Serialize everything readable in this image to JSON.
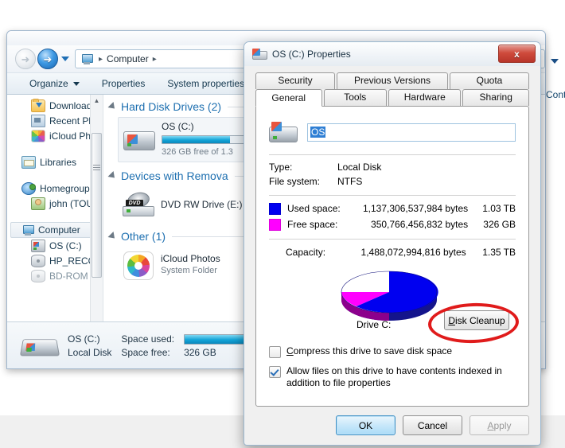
{
  "explorer": {
    "address": {
      "crumb_root": "Computer",
      "separator": "▸"
    },
    "nav": {
      "back_label": "back-arrow",
      "forward_label": "forward-arrow"
    },
    "toolbar": {
      "organize": "Organize",
      "properties": "Properties",
      "system_properties": "System properties",
      "control_panel_partial": "Contr"
    },
    "navpane": [
      {
        "label": "Downloads",
        "icon": "downloads-folder-icon",
        "indent": 2
      },
      {
        "label": "Recent Plac",
        "icon": "recent-places-icon",
        "indent": 2
      },
      {
        "label": "iCloud Pho",
        "icon": "icloud-photos-icon",
        "indent": 2
      },
      {
        "label": "Libraries",
        "icon": "libraries-icon",
        "indent": 1
      },
      {
        "label": "Homegroup",
        "icon": "homegroup-icon",
        "indent": 1
      },
      {
        "label": "john (TOUC",
        "icon": "user-icon",
        "indent": 2
      },
      {
        "label": "Computer",
        "icon": "computer-icon",
        "indent": 1,
        "selected": true
      },
      {
        "label": "OS (C:)",
        "icon": "hard-drive-windows-icon",
        "indent": 2
      },
      {
        "label": "HP_RECOV",
        "icon": "hard-drive-icon",
        "indent": 2
      },
      {
        "label": "BD-ROM D",
        "icon": "optical-drive-icon",
        "indent": 2
      }
    ],
    "groups": [
      {
        "title": "Hard Disk Drives (2)",
        "items": [
          {
            "name": "OS (C:)",
            "sub": "326 GB free of 1.3",
            "bar_percent": 76,
            "icon": "hard-drive-windows-icon",
            "selected": true
          }
        ]
      },
      {
        "title": "Devices with Remova",
        "items": [
          {
            "name": "DVD RW Drive (E:)",
            "sub": "",
            "icon": "dvd-drive-icon"
          }
        ]
      },
      {
        "title": "Other (1)",
        "items": [
          {
            "name": "iCloud Photos",
            "sub": "System Folder",
            "icon": "icloud-photos-icon"
          }
        ]
      }
    ],
    "statusbar": {
      "name": "OS (C:)",
      "type": "Local Disk",
      "space_used_label": "Space used:",
      "space_free_label": "Space free:",
      "space_free_value": "326 GB",
      "used_percent": 76
    }
  },
  "dialog": {
    "title": "OS (C:) Properties",
    "close_label": "x",
    "tabs_top": [
      {
        "label": "Security",
        "active": false
      },
      {
        "label": "Previous Versions",
        "active": false
      },
      {
        "label": "Quota",
        "active": false
      }
    ],
    "tabs_bottom": [
      {
        "label": "General",
        "active": true
      },
      {
        "label": "Tools",
        "active": false
      },
      {
        "label": "Hardware",
        "active": false
      },
      {
        "label": "Sharing",
        "active": false
      }
    ],
    "volume_name": "OS",
    "info": [
      {
        "key": "Type:",
        "value": "Local Disk"
      },
      {
        "key": "File system:",
        "value": "NTFS"
      }
    ],
    "usage": {
      "used": {
        "label": "Used space:",
        "bytes": "1,137,306,537,984 bytes",
        "human": "1.03 TB",
        "color": "#0000f0"
      },
      "free": {
        "label": "Free space:",
        "bytes": "350,766,456,832 bytes",
        "human": "326 GB",
        "color": "#ff00ff"
      },
      "capacity": {
        "label": "Capacity:",
        "bytes": "1,488,072,994,816 bytes",
        "human": "1.35 TB"
      }
    },
    "drive_label": "Drive C:",
    "disk_cleanup_button": "Disk Cleanup",
    "disk_cleanup_accel": "D",
    "annotation": {
      "shape": "red-ellipse",
      "color": "#e01b1b",
      "target": "Disk Cleanup"
    },
    "checkboxes": [
      {
        "label_accel": "C",
        "label": "ompress this drive to save disk space",
        "checked": false
      },
      {
        "label_accel": "",
        "label": "Allow files on this drive to have contents indexed in addition to file properties",
        "checked": true
      }
    ],
    "buttons": [
      {
        "label": "OK",
        "state": "default"
      },
      {
        "label": "Cancel",
        "state": "normal"
      },
      {
        "label": "Apply",
        "state": "disabled",
        "accel": "A"
      }
    ]
  },
  "chart_data": {
    "type": "pie",
    "title": "Drive C:",
    "labels": [
      "Used space",
      "Free space"
    ],
    "values": [
      1137306537984,
      350766456832
    ],
    "percentages": [
      76.4,
      23.6
    ],
    "human_values": [
      "1.03 TB",
      "326 GB"
    ],
    "colors": [
      "#0000f0",
      "#ff00ff"
    ],
    "total_bytes": 1488072994816,
    "total_human": "1.35 TB",
    "legend": "swatches-left",
    "style": "3d-pie"
  }
}
